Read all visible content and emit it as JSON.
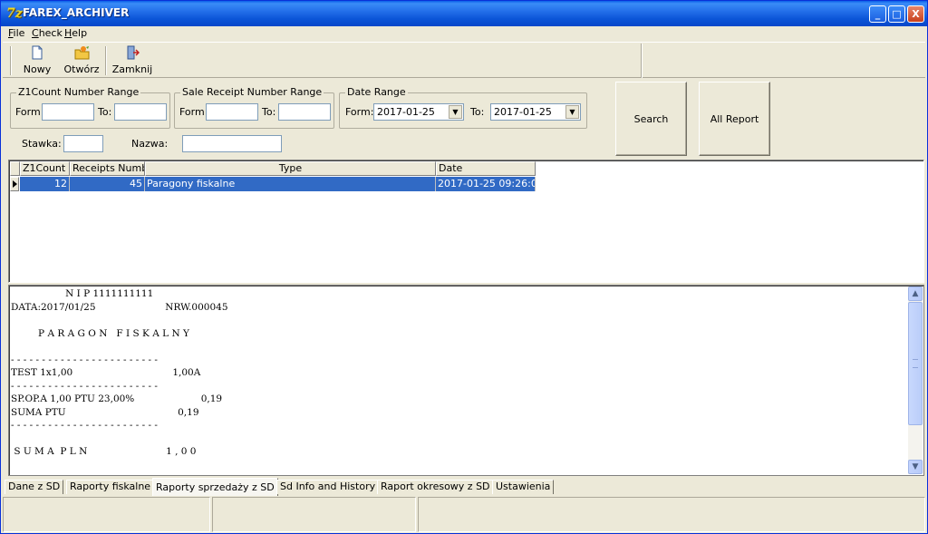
{
  "window": {
    "title": "FAREX_ARCHIVER",
    "icon": "7z-app-icon",
    "controls": {
      "minimize": "_",
      "maximize": "□",
      "close": "X"
    }
  },
  "menu": [
    {
      "underline": "F",
      "rest": "ile"
    },
    {
      "underline": "C",
      "rest": "heck"
    },
    {
      "underline": "H",
      "rest": "elp"
    }
  ],
  "toolbar": {
    "new_label": "Nowy",
    "open_label": "Otwórz",
    "close_label": "Zamknij"
  },
  "filters": {
    "z1_group": "Z1Count Number Range",
    "sale_group": "Sale Receipt Number Range",
    "date_group": "Date Range",
    "from_label": "Form",
    "to_label": "To:",
    "date_from_label": "Form:",
    "date_from_value": "2017-01-25",
    "date_to_label": "To:",
    "date_to_value": "2017-01-25",
    "stawka_label": "Stawka:",
    "nazwa_label": "Nazwa:"
  },
  "buttons": {
    "search": "Search",
    "all_report": "All Report"
  },
  "grid": {
    "columns": [
      "Z1Count",
      "Receipts Numbe",
      "Type",
      "Date"
    ],
    "rows": [
      [
        "12",
        "45",
        "Paragony fiskalne",
        "2017-01-25 09:26:0("
      ]
    ]
  },
  "receipt_lines": [
    "                  N I P 1111111111",
    "DATA:2017/01/25                       NRW.000045",
    "",
    "         P A R A G O N   F I S K A L N Y",
    "",
    "- - - - - - - - - - - - - - - - - - - - - - - -",
    "TEST 1x1,00                                 1,00A",
    "- - - - - - - - - - - - - - - - - - - - - - - -",
    "SP.OP.A 1,00 PTU 23,00%                      0,19",
    "SUMA PTU                                     0,19",
    "- - - - - - - - - - - - - - - - - - - - - - - -",
    "",
    " S U M A  P L N                          1 , 0 0"
  ],
  "tabs": [
    "Dane z SD",
    "Raporty fiskalne",
    "Raporty sprzedaży z SD",
    "Sd Info and History",
    "Raport okresowy z SD",
    "Ustawienia"
  ],
  "active_tab": "Raporty sprzedaży z SD"
}
